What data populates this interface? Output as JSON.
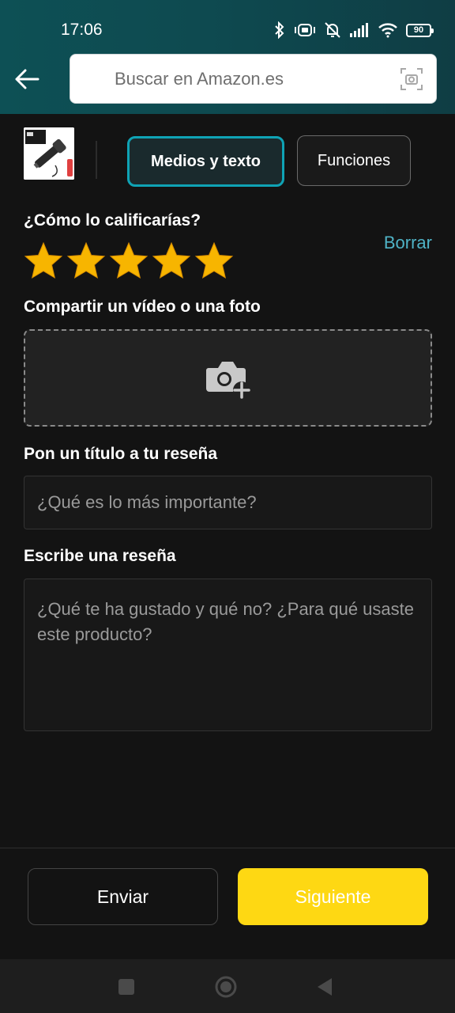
{
  "status_bar": {
    "time": "17:06",
    "battery": "90",
    "icons": [
      "bluetooth-icon",
      "vibrate-icon",
      "mute-icon",
      "signal-icon",
      "wifi-icon",
      "battery-icon"
    ]
  },
  "header": {
    "back_icon": "back-arrow-icon",
    "search": {
      "placeholder": "Buscar en Amazon.es",
      "value": ""
    },
    "scan_icon": "camera-scan-icon"
  },
  "product": {
    "thumbnail": "flashlight-product-image"
  },
  "tabs": [
    {
      "label": "Medios y texto",
      "active": true
    },
    {
      "label": "Funciones",
      "active": false
    }
  ],
  "rating": {
    "question": "¿Cómo lo calificarías?",
    "clear_label": "Borrar",
    "value": 5,
    "max": 5
  },
  "media": {
    "label": "Compartir un vídeo o una foto",
    "icon": "add-photo-icon"
  },
  "title_section": {
    "label": "Pon un título a tu reseña",
    "placeholder": "¿Qué es lo más importante?",
    "value": ""
  },
  "review_section": {
    "label": "Escribe una reseña",
    "placeholder": "¿Qué te ha gustado y qué no? ¿Para qué usaste este producto?",
    "value": ""
  },
  "footer": {
    "send_label": "Enviar",
    "next_label": "Siguiente"
  },
  "colors": {
    "accent_teal": "#0fa3b5",
    "link": "#4fb3c6",
    "star": "#f7b500",
    "next_button": "#fed813",
    "background": "#131313"
  }
}
